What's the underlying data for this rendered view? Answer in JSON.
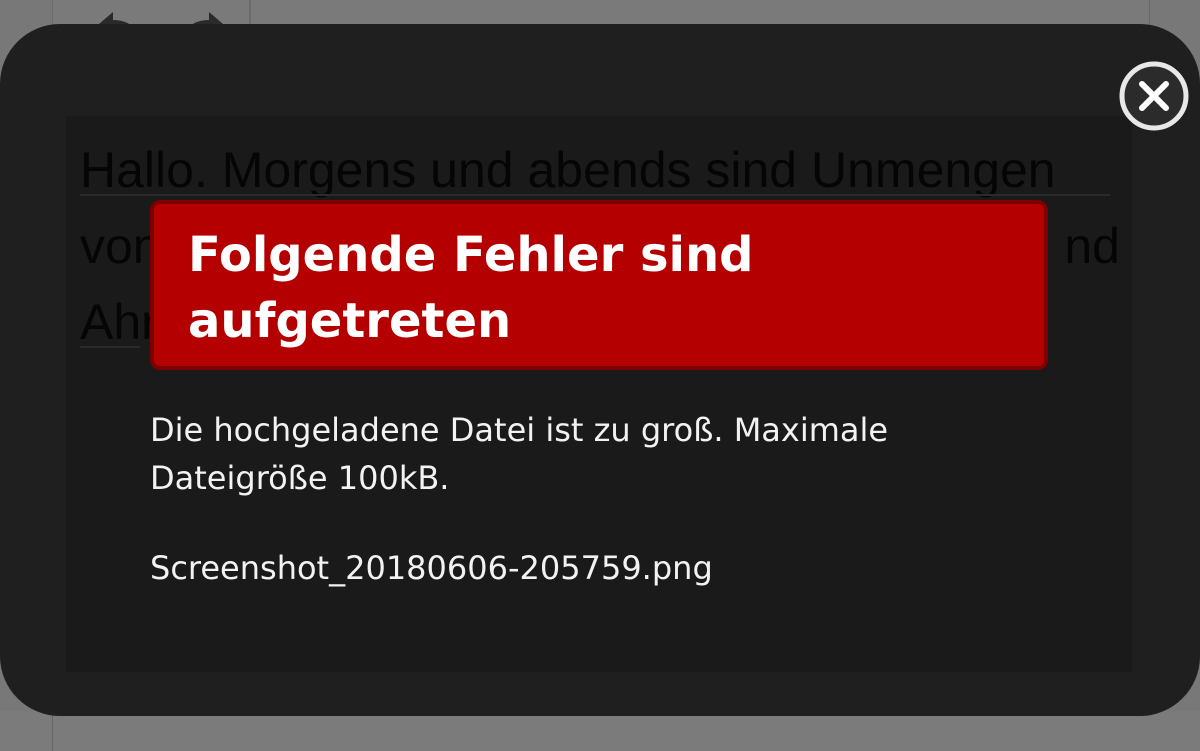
{
  "background_editor": {
    "text": "Hallo. Morgens und abends sind Unmengen von ... und Ahn",
    "line1": "Hallo. Morgens und abends sind Unmengen",
    "line2_start": "von",
    "line2_end": "nd",
    "line3_start": "Ahr"
  },
  "toolbar": {
    "undo_icon": "undo-icon",
    "redo_icon": "redo-icon"
  },
  "dialog": {
    "close_icon": "close-icon",
    "error_title": "Folgende Fehler sind aufgetreten",
    "error_message": "Die hochgeladene Datei ist zu groß. Maximale Dateigröße 100kB.",
    "file_name": "Screenshot_20180606-205759.png"
  },
  "colors": {
    "error_red": "#b40000",
    "modal_bg": "#1f1f1f",
    "overlay_gray": "#7d7d7d"
  }
}
